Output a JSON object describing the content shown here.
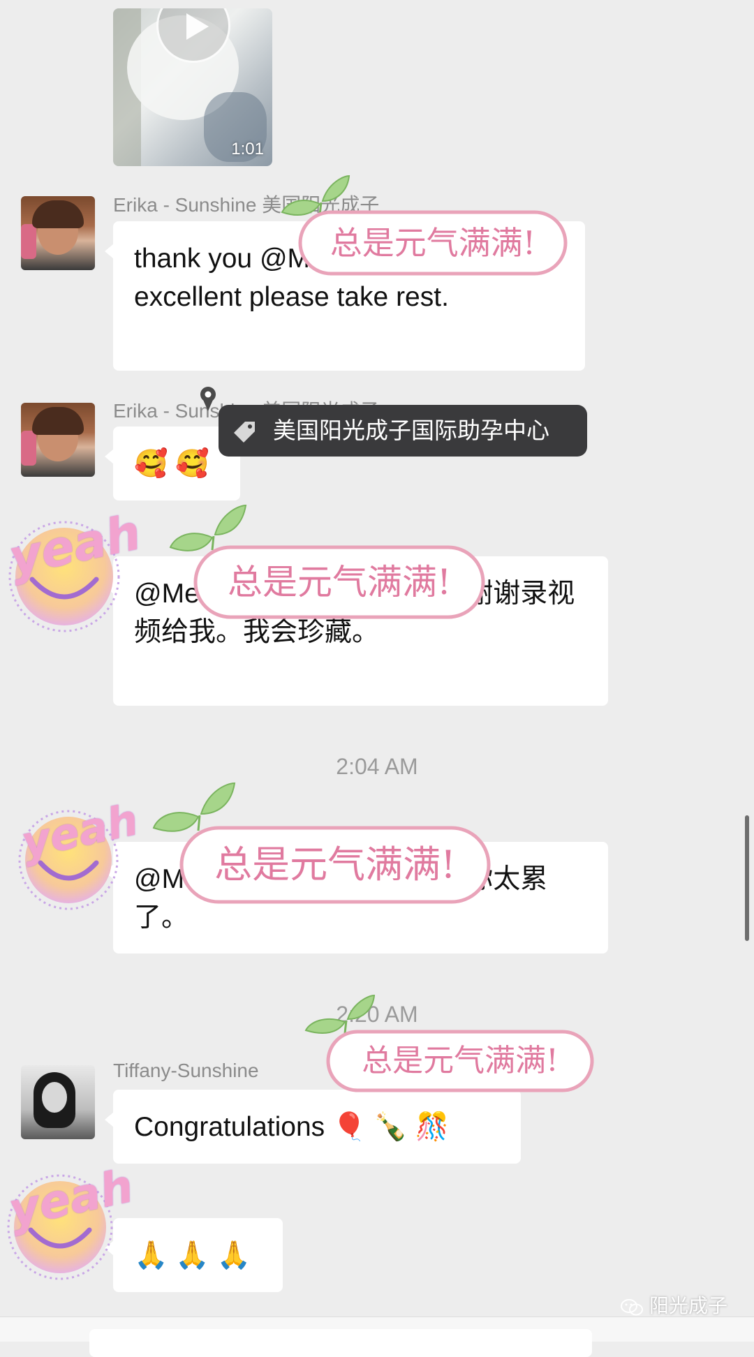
{
  "video_message": {
    "duration": "1:01"
  },
  "messages": [
    {
      "sender": "Erika - Sunshine 美国阳光成子",
      "text": "thank you @Merit Zepeda , excellent please take rest."
    },
    {
      "sender": "Erika - Sunshine 美国阳光成子",
      "text": "🥰 🥰"
    },
    {
      "text": "@Merit Zepeda 太感动了！谢谢录视频给我。我会珍藏。"
    },
    {
      "text": "@Merit Zepeda 先休息吧，你太累了。"
    },
    {
      "sender": "Tiffany-Sunshine",
      "text": "Congratulations 🎈 🍾 🎊"
    },
    {
      "text": "🙏 🙏 🙏"
    }
  ],
  "timestamps": [
    "2:04 AM",
    "2:20 AM"
  ],
  "tag_tooltip": {
    "text": "美国阳光成子国际助孕中心",
    "icon": "tag-icon"
  },
  "stickers": {
    "banner_text": "总是元气满满!",
    "yeah_text": "yeah"
  },
  "watermark": {
    "text": "阳光成子",
    "icon": "wechat-icon"
  },
  "colors": {
    "background": "#ededed",
    "bubble": "#ffffff",
    "banner_border": "#e9a3b9",
    "leaf": "#a6d58a",
    "yeah_text": "#f2a3cf"
  }
}
